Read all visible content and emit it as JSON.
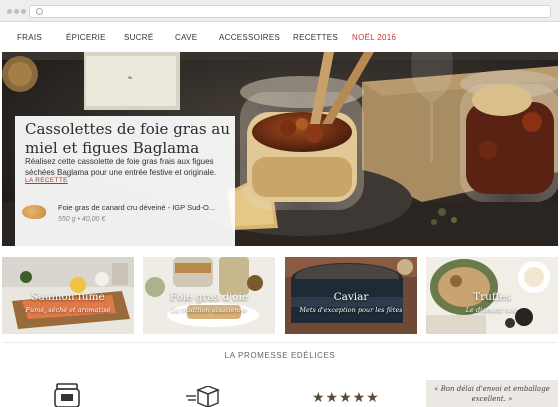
{
  "nav": {
    "items": [
      "FRAIS",
      "ÉPICERIE",
      "SUCRÉ",
      "CAVE",
      "ACCESSOIRES",
      "RECETTES",
      "NOËL 2016"
    ]
  },
  "hero": {
    "title": "Cassolettes de foie gras au miel et figues Baglama",
    "description": "Réalisez cette cassolette de foie gras frais aux figues séchées Baglama pour une entrée festive et originale.",
    "link_label": "LA RECETTE",
    "product": {
      "name": "Foie gras de canard cru déveiné - IGP Sud-O...",
      "price": "550 g • 40,00 €"
    }
  },
  "tiles": [
    {
      "title": "Saumon fumé",
      "subtitle": "Fumé, séché et aromatisé"
    },
    {
      "title": "Foie gras d'oie",
      "subtitle": "La tradition alsacienne"
    },
    {
      "title": "Caviar",
      "subtitle": "Mets d'exception pour les fêtes"
    },
    {
      "title": "Truffes",
      "subtitle": "Le diamant noir"
    }
  ],
  "promise": {
    "title": "LA PROMESSE EDÉLICES",
    "rating_stars": "★★★★★",
    "quote": "« Bon délai d'envoi et emballage excellent. »"
  },
  "colors": {
    "accent": "#c0392b",
    "link": "#b03a2e",
    "stars": "#5a4a3a"
  },
  "icons": [
    "jar-icon",
    "boxes-icon"
  ]
}
